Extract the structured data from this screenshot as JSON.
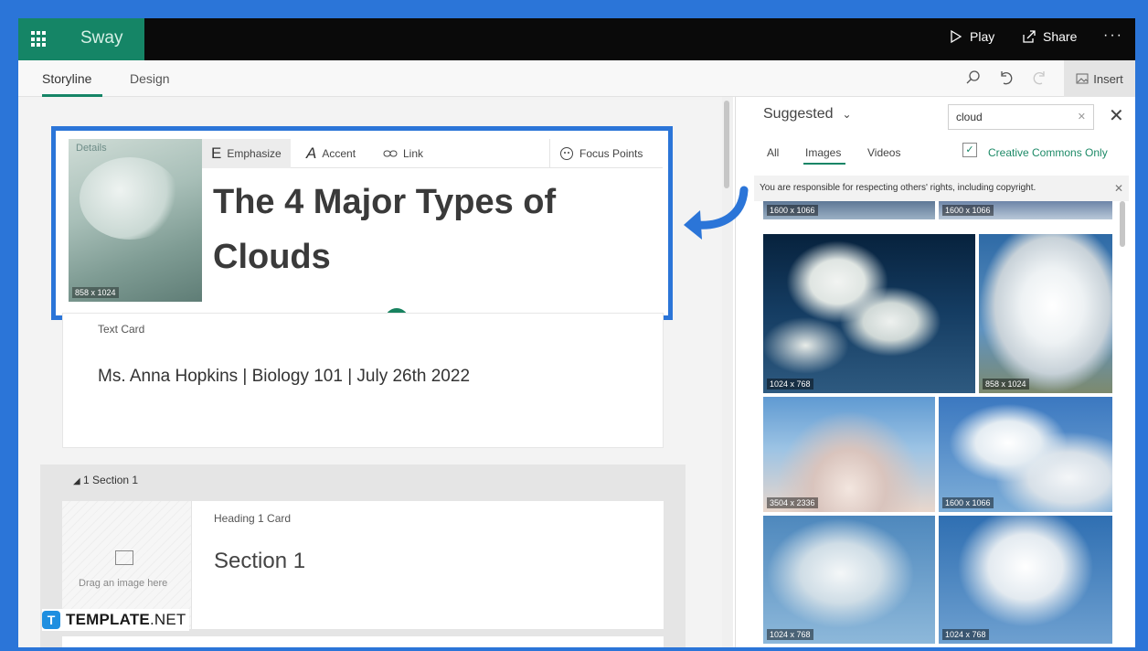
{
  "app": {
    "name": "Sway"
  },
  "topbar": {
    "play_label": "Play",
    "share_label": "Share",
    "more_label": "···"
  },
  "tabs": {
    "storyline": "Storyline",
    "design": "Design",
    "insert_label": "Insert"
  },
  "title_card": {
    "details_label": "Details",
    "thumb_dims": "858 x 1024",
    "tools": {
      "emphasize": "Emphasize",
      "accent": "Accent",
      "link": "Link",
      "focus_points": "Focus Points"
    },
    "title": "The 4 Major Types of Clouds",
    "add_symbol": "+"
  },
  "text_card": {
    "label": "Text Card",
    "body": "Ms. Anna Hopkins  |  Biology 101  |  July 26th 2022"
  },
  "section": {
    "header": "1  Section 1",
    "heading_card_label": "Heading 1 Card",
    "heading_text": "Section 1",
    "image_drop_text": "Drag an image here"
  },
  "watermark": {
    "logo_letter": "T",
    "name_bold": "TEMPLATE",
    "name_light": ".NET"
  },
  "insert_pane": {
    "dropdown_label": "Suggested",
    "search_value": "cloud",
    "filters": {
      "all": "All",
      "images": "Images",
      "videos": "Videos"
    },
    "creative_commons_label": "Creative Commons Only",
    "creative_commons_checked": true,
    "notice": "You are responsible for respecting others' rights, including copyright.",
    "images": [
      {
        "dims": "1600 x 1066"
      },
      {
        "dims": "1600 x 1066"
      },
      {
        "dims": "1024 x 768"
      },
      {
        "dims": "858 x 1024"
      },
      {
        "dims": "3504 x 2336"
      },
      {
        "dims": "1600 x 1066"
      },
      {
        "dims": "1024 x 768"
      },
      {
        "dims": "1024 x 768"
      }
    ]
  },
  "colors": {
    "highlight": "#2b75d8",
    "brand": "#158566",
    "topbar": "#0a0a0a"
  }
}
